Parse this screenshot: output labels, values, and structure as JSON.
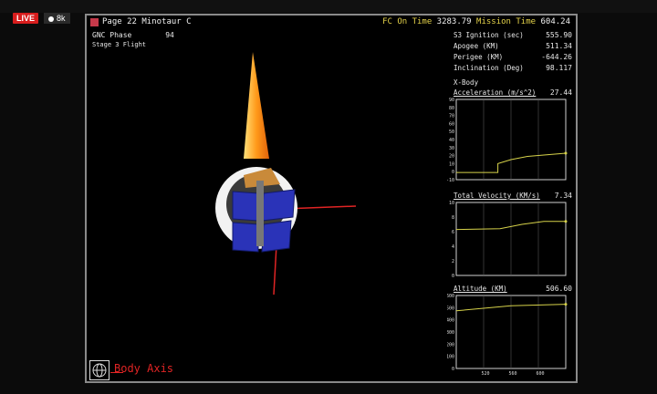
{
  "stream": {
    "live_label": "LIVE",
    "viewer_count": "8k"
  },
  "header": {
    "page_title": "Page 22 Minotaur C",
    "fc_on_time_label": "FC On Time",
    "fc_on_time_value": "3283.79",
    "mission_time_label": "Mission Time",
    "mission_time_value": "604.24"
  },
  "gnc": {
    "label": "GNC Phase",
    "value": "94",
    "stage": "Stage 3 Flight"
  },
  "params": [
    {
      "label": "S3 Ignition (sec)",
      "value": "555.90"
    },
    {
      "label": "Apogee (KM)",
      "value": "511.34"
    },
    {
      "label": "Perigee (KM)",
      "value": "-644.26"
    },
    {
      "label": "Inclination (Deg)",
      "value": "98.117"
    }
  ],
  "xbody_label": "X-Body",
  "charts": [
    {
      "title": "Acceleration (m/s^2)",
      "value": "27.44",
      "y_ticks": [
        "90",
        "80",
        "70",
        "60",
        "50",
        "40",
        "30",
        "20",
        "10",
        "0",
        "-10"
      ],
      "x_ticks": []
    },
    {
      "title": "Total Velocity (KM/s)",
      "value": "7.34",
      "y_ticks": [
        "10",
        "8",
        "6",
        "4",
        "2",
        "0"
      ],
      "x_ticks": []
    },
    {
      "title": "Altitude (KM)",
      "value": "506.60",
      "y_ticks": [
        "600",
        "500",
        "400",
        "300",
        "200",
        "100",
        "0"
      ],
      "x_ticks": [
        "520",
        "560",
        "600"
      ]
    }
  ],
  "footer": {
    "axis_label": "Body Axis"
  },
  "colors": {
    "trace": "#d6d24a",
    "axis_red": "#e02424",
    "accent_yellow": "#e4d24a"
  }
}
